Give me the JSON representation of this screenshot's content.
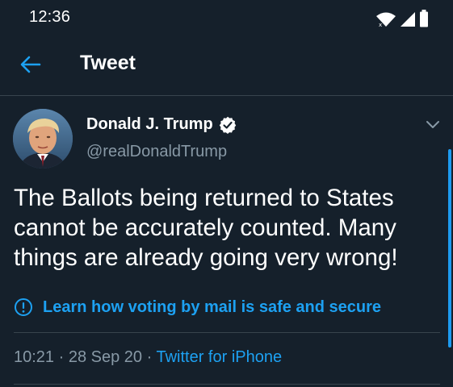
{
  "status_bar": {
    "time": "12:36",
    "icons": [
      "wifi-icon",
      "cell-signal-icon",
      "battery-icon"
    ]
  },
  "header": {
    "back_icon": "arrow-left-icon",
    "title": "Tweet"
  },
  "tweet": {
    "author_name": "Donald J. Trump",
    "verified": true,
    "handle": "@realDonaldTrump",
    "text": "The Ballots being returned to States cannot be accurately counted. Many things are already going very wrong!",
    "notice": {
      "icon": "exclamation-circle-icon",
      "label": "Learn how voting by mail is safe and secure"
    },
    "time": "10:21",
    "separator1": " · ",
    "date": "28 Sep 20",
    "separator2": " · ",
    "source": "Twitter for iPhone"
  },
  "colors": {
    "background": "#15202b",
    "accent": "#1da1f2",
    "muted": "#8899a6",
    "divider": "#38444d"
  }
}
